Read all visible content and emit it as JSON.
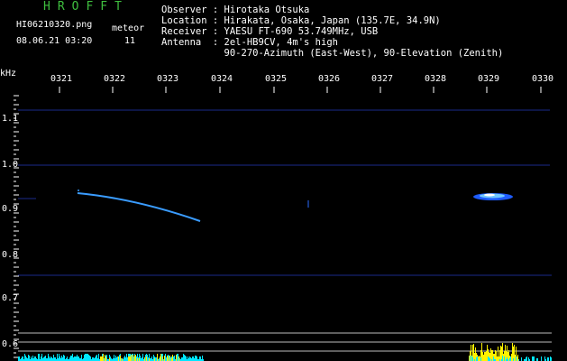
{
  "header": {
    "title": "HROFFT",
    "filename": "HI06210320.png",
    "datetime": "08.06.21 03:20",
    "meteor_label": "meteor",
    "meteor_count": "11"
  },
  "info": {
    "observer": "Observer : Hirotaka Otsuka",
    "location": "Location : Hirakata, Osaka, Japan (135.7E, 34.9N)",
    "receiver": "Receiver : YAESU FT-690 53.749MHz, USB",
    "antenna": "Antenna  : 2el-HB9CV, 4m's high",
    "antenna2": "           90-270-Azimuth (East-West), 90-Elevation (Zenith)"
  },
  "axis": {
    "unit": "kHz",
    "time_labels": [
      "0321",
      "0322",
      "0323",
      "0324",
      "0325",
      "0326",
      "0327",
      "0328",
      "0329",
      "0330"
    ],
    "freq_labels": [
      "1.1",
      "1.0",
      "0.9",
      "0.8",
      "0.7",
      "0.6"
    ]
  },
  "colors": {
    "title": "#3fbf3f",
    "text": "#ffffff",
    "grid": "#1a2a8a",
    "trace": "#3a9cff",
    "bars_cyan": "#00e6ff",
    "bars_yellow": "#fff200"
  }
}
